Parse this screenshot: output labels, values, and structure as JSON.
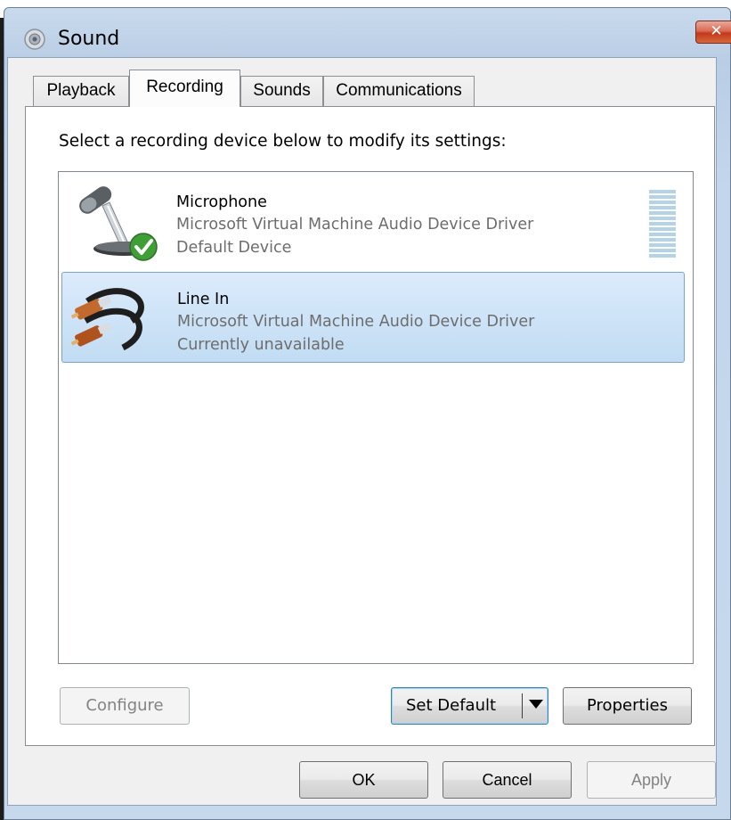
{
  "window": {
    "title": "Sound",
    "close_label": "✕"
  },
  "tabs": [
    {
      "label": "Playback",
      "active": false
    },
    {
      "label": "Recording",
      "active": true
    },
    {
      "label": "Sounds",
      "active": false
    },
    {
      "label": "Communications",
      "active": false
    }
  ],
  "recording": {
    "instruction": "Select a recording device below to modify its settings:",
    "devices": [
      {
        "name": "Microphone",
        "driver": "Microsoft Virtual Machine Audio Device Driver",
        "status": "Default Device",
        "icon": "microphone-icon",
        "default_badge": "green-checkmark-icon",
        "selected": false,
        "level": 0
      },
      {
        "name": "Line In",
        "driver": "Microsoft Virtual Machine Audio Device Driver",
        "status": "Currently unavailable",
        "icon": "line-in-cable-icon",
        "selected": true
      }
    ],
    "buttons": {
      "configure": "Configure",
      "set_default": "Set Default",
      "properties": "Properties"
    }
  },
  "dialog_buttons": {
    "ok": "OK",
    "cancel": "Cancel",
    "apply": "Apply"
  },
  "colors": {
    "selection_border": "#7da2ce",
    "selection_fill": "#c1dcf3",
    "close_button": "#c3391d",
    "level_meter": "#b5d3e7"
  }
}
